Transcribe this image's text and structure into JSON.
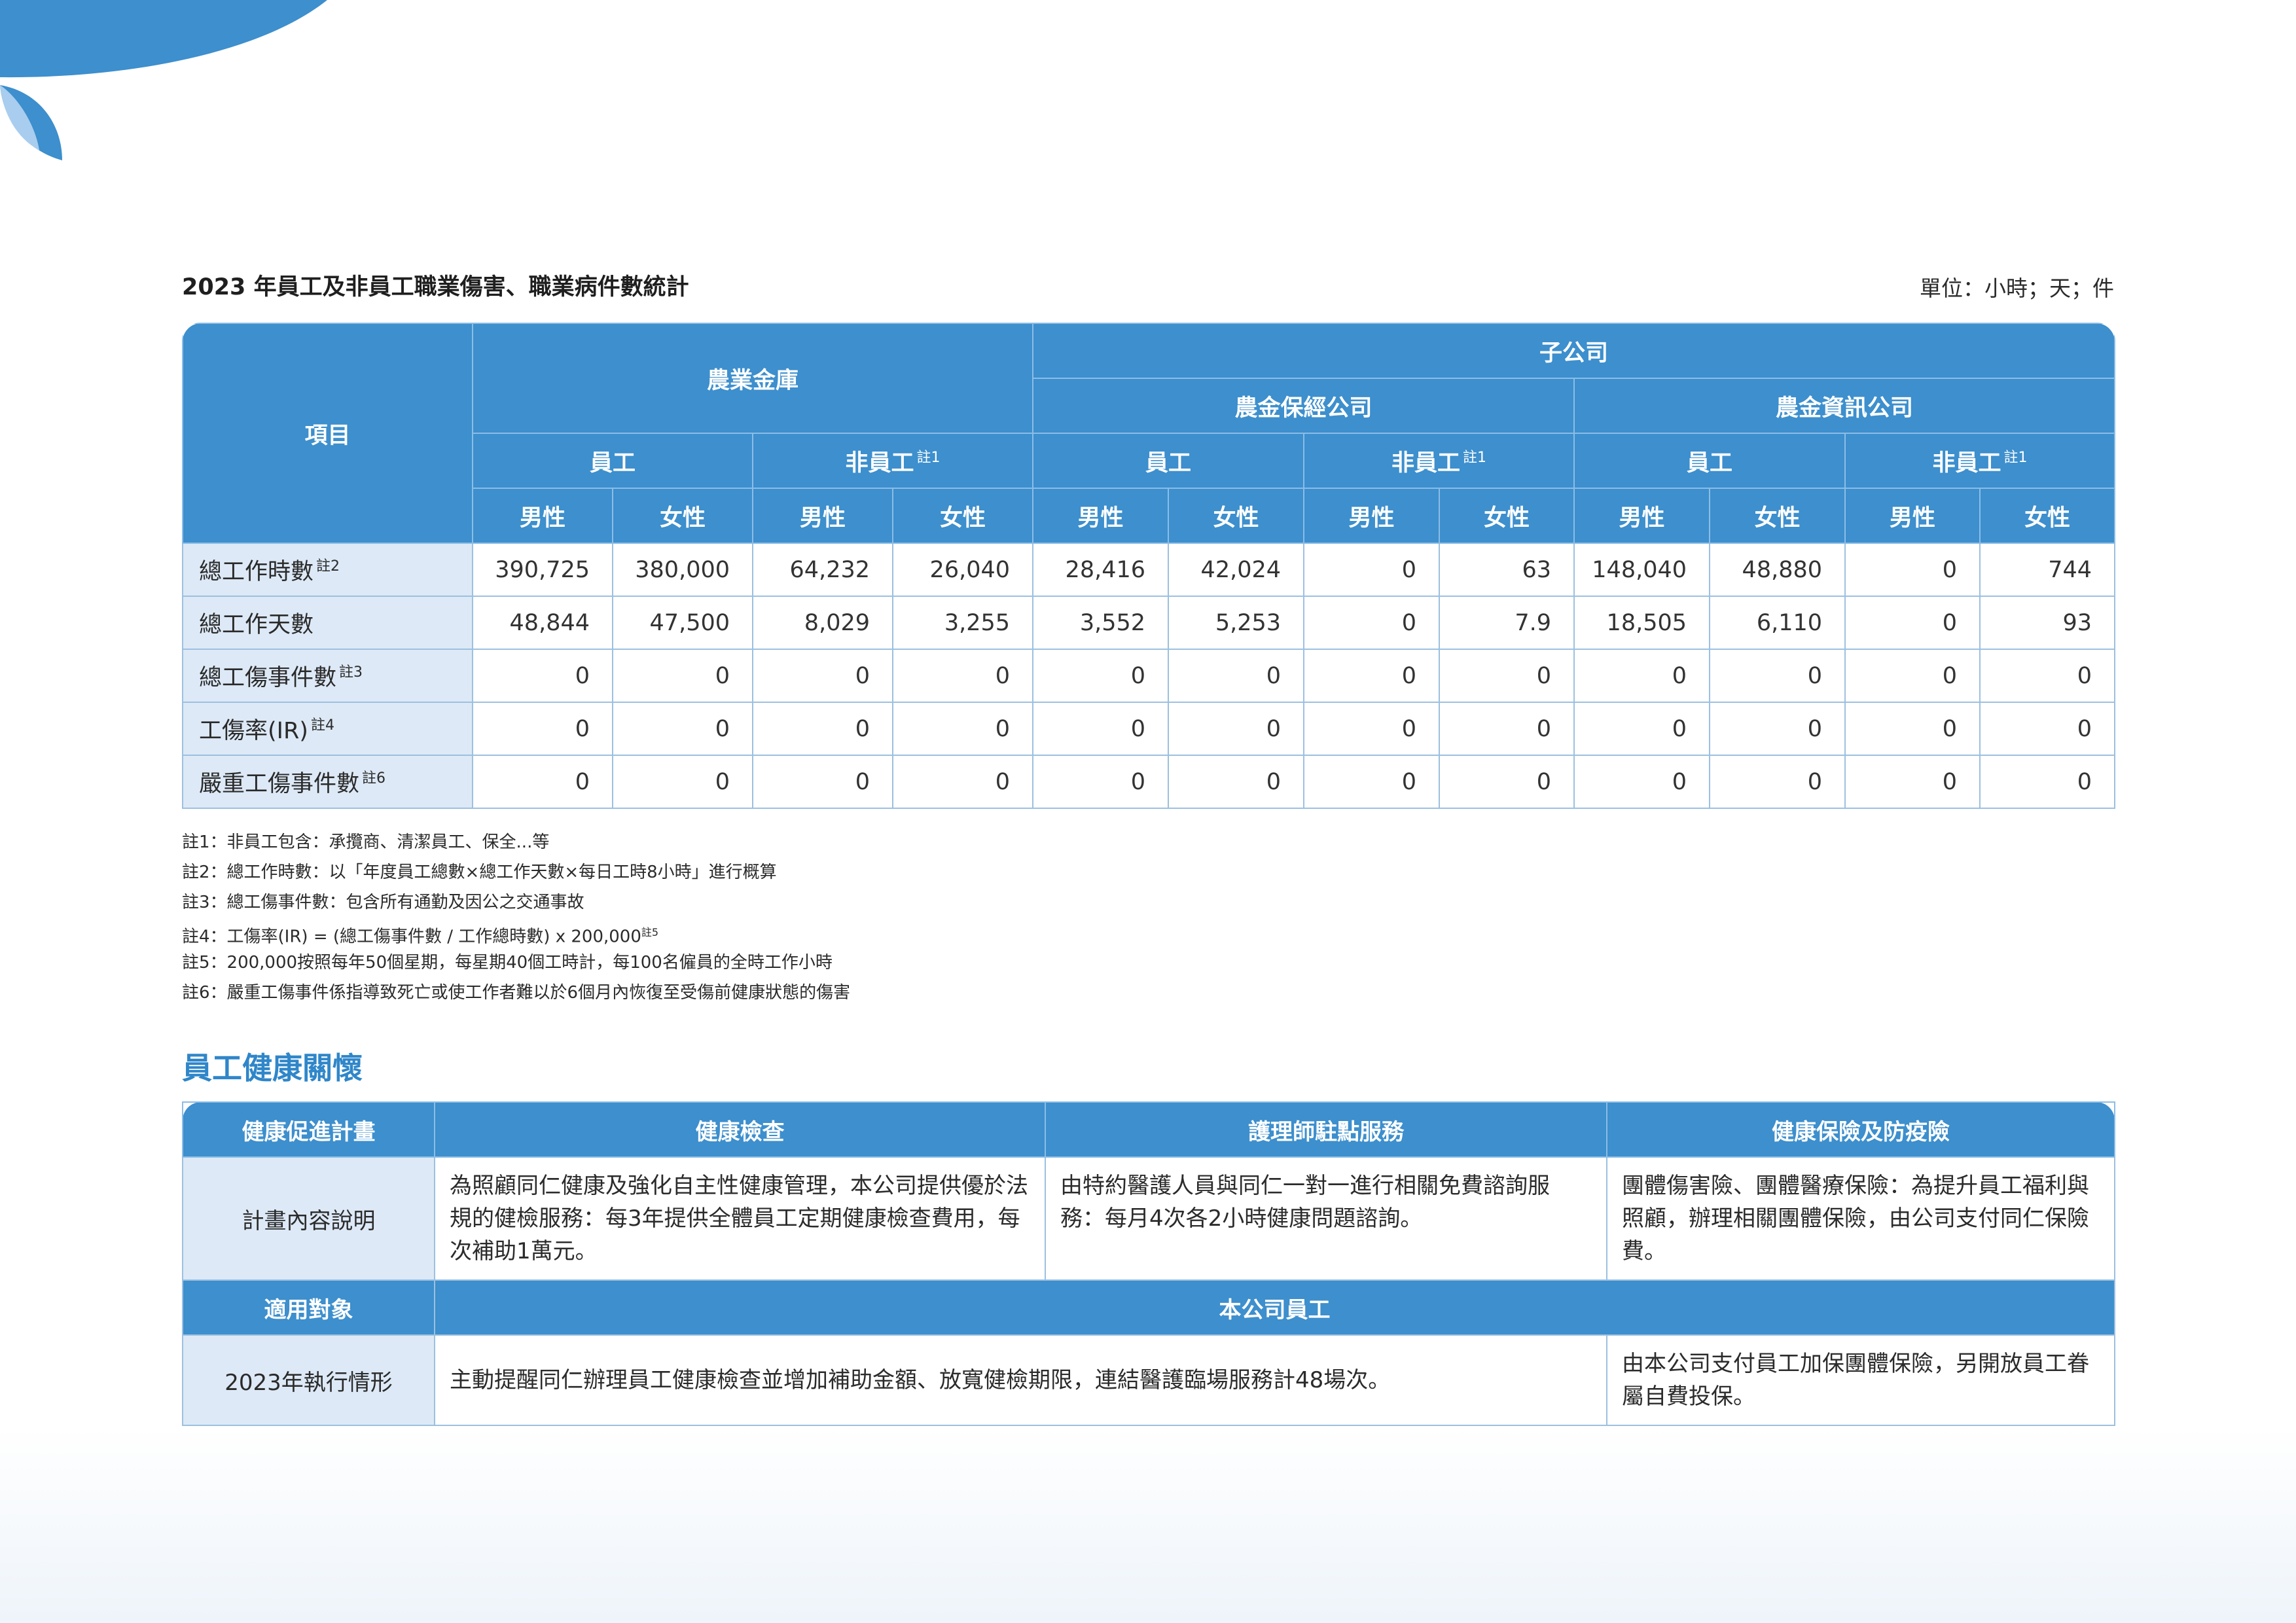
{
  "stats": {
    "title": "2023 年員工及非員工職業傷害、職業病件數統計",
    "unit": "單位：小時；天；件",
    "header": {
      "item": "項目",
      "company1": "農業金庫",
      "subsidiaries": "子公司",
      "company2": "農金保經公司",
      "company3": "農金資訊公司",
      "employee": "員工",
      "non_employee": "非員工",
      "note1": "註1",
      "male": "男性",
      "female": "女性"
    },
    "rows": [
      {
        "label": "總工作時數",
        "note": "註2",
        "values": [
          "390,725",
          "380,000",
          "64,232",
          "26,040",
          "28,416",
          "42,024",
          "0",
          "63",
          "148,040",
          "48,880",
          "0",
          "744"
        ]
      },
      {
        "label": "總工作天數",
        "note": "",
        "values": [
          "48,844",
          "47,500",
          "8,029",
          "3,255",
          "3,552",
          "5,253",
          "0",
          "7.9",
          "18,505",
          "6,110",
          "0",
          "93"
        ]
      },
      {
        "label": "總工傷事件數",
        "note": "註3",
        "values": [
          "0",
          "0",
          "0",
          "0",
          "0",
          "0",
          "0",
          "0",
          "0",
          "0",
          "0",
          "0"
        ]
      },
      {
        "label": "工傷率(IR)",
        "note": "註4",
        "values": [
          "0",
          "0",
          "0",
          "0",
          "0",
          "0",
          "0",
          "0",
          "0",
          "0",
          "0",
          "0"
        ]
      },
      {
        "label": "嚴重工傷事件數",
        "note": "註6",
        "values": [
          "0",
          "0",
          "0",
          "0",
          "0",
          "0",
          "0",
          "0",
          "0",
          "0",
          "0",
          "0"
        ]
      }
    ]
  },
  "notes": {
    "n1": "註1：非員工包含：承攬商、清潔員工、保全...等",
    "n2": "註2：總工作時數：以「年度員工總數×總工作天數×每日工時8小時」進行概算",
    "n3": "註3：總工傷事件數：包含所有通勤及因公之交通事故",
    "n4": "註4：工傷率(IR) = (總工傷事件數 / 工作總時數) x 200,000",
    "n4_sup": "註5",
    "n5": "註5：200,000按照每年50個星期，每星期40個工時計，每100名僱員的全時工作小時",
    "n6": "註6：嚴重工傷事件係指導致死亡或使工作者難以於6個月內恢復至受傷前健康狀態的傷害"
  },
  "health": {
    "heading": "員工健康關懷",
    "col0": "健康促進計畫",
    "col1": "健康檢查",
    "col2": "護理師駐點服務",
    "col3": "健康保險及防疫險",
    "row1_label": "計畫內容說明",
    "row1_c1": "為照顧同仁健康及強化自主性健康管理，本公司提供優於法規的健檢服務：每3年提供全體員工定期健康檢查費用，每次補助1萬元。",
    "row1_c2": "由特約醫護人員與同仁一對一進行相關免費諮詢服務：每月4次各2小時健康問題諮詢。",
    "row1_c3": "團體傷害險、團體醫療保險：為提升員工福利與照顧，辦理相關團體保險，由公司支付同仁保險費。",
    "row2_label": "適用對象",
    "row2_value": "本公司員工",
    "row3_label": "2023年執行情形",
    "row3_c12": "主動提醒同仁辦理員工健康檢查並增加補助金額、放寬健檢期限，連結醫護臨場服務計48場次。",
    "row3_c3": "由本公司支付員工加保團體保險，另開放員工眷屬自費投保。"
  },
  "colors": {
    "header_blue": "#3d8fcd",
    "label_bg": "#dde9f6",
    "heading_blue": "#2f86c9"
  }
}
